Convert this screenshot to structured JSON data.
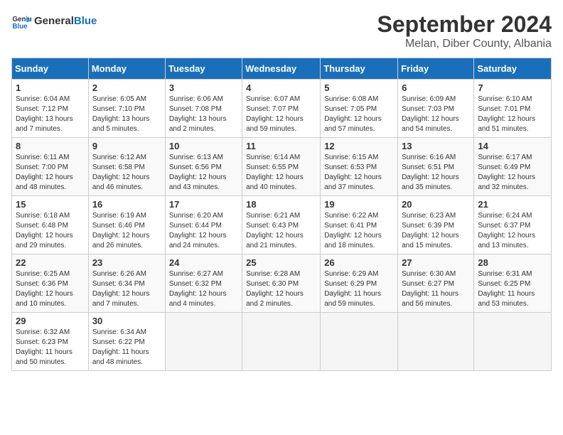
{
  "header": {
    "logo_general": "General",
    "logo_blue": "Blue",
    "title": "September 2024",
    "subtitle": "Melan, Diber County, Albania"
  },
  "days_of_week": [
    "Sunday",
    "Monday",
    "Tuesday",
    "Wednesday",
    "Thursday",
    "Friday",
    "Saturday"
  ],
  "weeks": [
    [
      {
        "day": "1",
        "info": "Sunrise: 6:04 AM\nSunset: 7:12 PM\nDaylight: 13 hours\nand 7 minutes."
      },
      {
        "day": "2",
        "info": "Sunrise: 6:05 AM\nSunset: 7:10 PM\nDaylight: 13 hours\nand 5 minutes."
      },
      {
        "day": "3",
        "info": "Sunrise: 6:06 AM\nSunset: 7:08 PM\nDaylight: 13 hours\nand 2 minutes."
      },
      {
        "day": "4",
        "info": "Sunrise: 6:07 AM\nSunset: 7:07 PM\nDaylight: 12 hours\nand 59 minutes."
      },
      {
        "day": "5",
        "info": "Sunrise: 6:08 AM\nSunset: 7:05 PM\nDaylight: 12 hours\nand 57 minutes."
      },
      {
        "day": "6",
        "info": "Sunrise: 6:09 AM\nSunset: 7:03 PM\nDaylight: 12 hours\nand 54 minutes."
      },
      {
        "day": "7",
        "info": "Sunrise: 6:10 AM\nSunset: 7:01 PM\nDaylight: 12 hours\nand 51 minutes."
      }
    ],
    [
      {
        "day": "8",
        "info": "Sunrise: 6:11 AM\nSunset: 7:00 PM\nDaylight: 12 hours\nand 48 minutes."
      },
      {
        "day": "9",
        "info": "Sunrise: 6:12 AM\nSunset: 6:58 PM\nDaylight: 12 hours\nand 46 minutes."
      },
      {
        "day": "10",
        "info": "Sunrise: 6:13 AM\nSunset: 6:56 PM\nDaylight: 12 hours\nand 43 minutes."
      },
      {
        "day": "11",
        "info": "Sunrise: 6:14 AM\nSunset: 6:55 PM\nDaylight: 12 hours\nand 40 minutes."
      },
      {
        "day": "12",
        "info": "Sunrise: 6:15 AM\nSunset: 6:53 PM\nDaylight: 12 hours\nand 37 minutes."
      },
      {
        "day": "13",
        "info": "Sunrise: 6:16 AM\nSunset: 6:51 PM\nDaylight: 12 hours\nand 35 minutes."
      },
      {
        "day": "14",
        "info": "Sunrise: 6:17 AM\nSunset: 6:49 PM\nDaylight: 12 hours\nand 32 minutes."
      }
    ],
    [
      {
        "day": "15",
        "info": "Sunrise: 6:18 AM\nSunset: 6:48 PM\nDaylight: 12 hours\nand 29 minutes."
      },
      {
        "day": "16",
        "info": "Sunrise: 6:19 AM\nSunset: 6:46 PM\nDaylight: 12 hours\nand 26 minutes."
      },
      {
        "day": "17",
        "info": "Sunrise: 6:20 AM\nSunset: 6:44 PM\nDaylight: 12 hours\nand 24 minutes."
      },
      {
        "day": "18",
        "info": "Sunrise: 6:21 AM\nSunset: 6:43 PM\nDaylight: 12 hours\nand 21 minutes."
      },
      {
        "day": "19",
        "info": "Sunrise: 6:22 AM\nSunset: 6:41 PM\nDaylight: 12 hours\nand 18 minutes."
      },
      {
        "day": "20",
        "info": "Sunrise: 6:23 AM\nSunset: 6:39 PM\nDaylight: 12 hours\nand 15 minutes."
      },
      {
        "day": "21",
        "info": "Sunrise: 6:24 AM\nSunset: 6:37 PM\nDaylight: 12 hours\nand 13 minutes."
      }
    ],
    [
      {
        "day": "22",
        "info": "Sunrise: 6:25 AM\nSunset: 6:36 PM\nDaylight: 12 hours\nand 10 minutes."
      },
      {
        "day": "23",
        "info": "Sunrise: 6:26 AM\nSunset: 6:34 PM\nDaylight: 12 hours\nand 7 minutes."
      },
      {
        "day": "24",
        "info": "Sunrise: 6:27 AM\nSunset: 6:32 PM\nDaylight: 12 hours\nand 4 minutes."
      },
      {
        "day": "25",
        "info": "Sunrise: 6:28 AM\nSunset: 6:30 PM\nDaylight: 12 hours\nand 2 minutes."
      },
      {
        "day": "26",
        "info": "Sunrise: 6:29 AM\nSunset: 6:29 PM\nDaylight: 11 hours\nand 59 minutes."
      },
      {
        "day": "27",
        "info": "Sunrise: 6:30 AM\nSunset: 6:27 PM\nDaylight: 11 hours\nand 56 minutes."
      },
      {
        "day": "28",
        "info": "Sunrise: 6:31 AM\nSunset: 6:25 PM\nDaylight: 11 hours\nand 53 minutes."
      }
    ],
    [
      {
        "day": "29",
        "info": "Sunrise: 6:32 AM\nSunset: 6:23 PM\nDaylight: 11 hours\nand 50 minutes."
      },
      {
        "day": "30",
        "info": "Sunrise: 6:34 AM\nSunset: 6:22 PM\nDaylight: 11 hours\nand 48 minutes."
      },
      {
        "day": "",
        "info": ""
      },
      {
        "day": "",
        "info": ""
      },
      {
        "day": "",
        "info": ""
      },
      {
        "day": "",
        "info": ""
      },
      {
        "day": "",
        "info": ""
      }
    ]
  ]
}
